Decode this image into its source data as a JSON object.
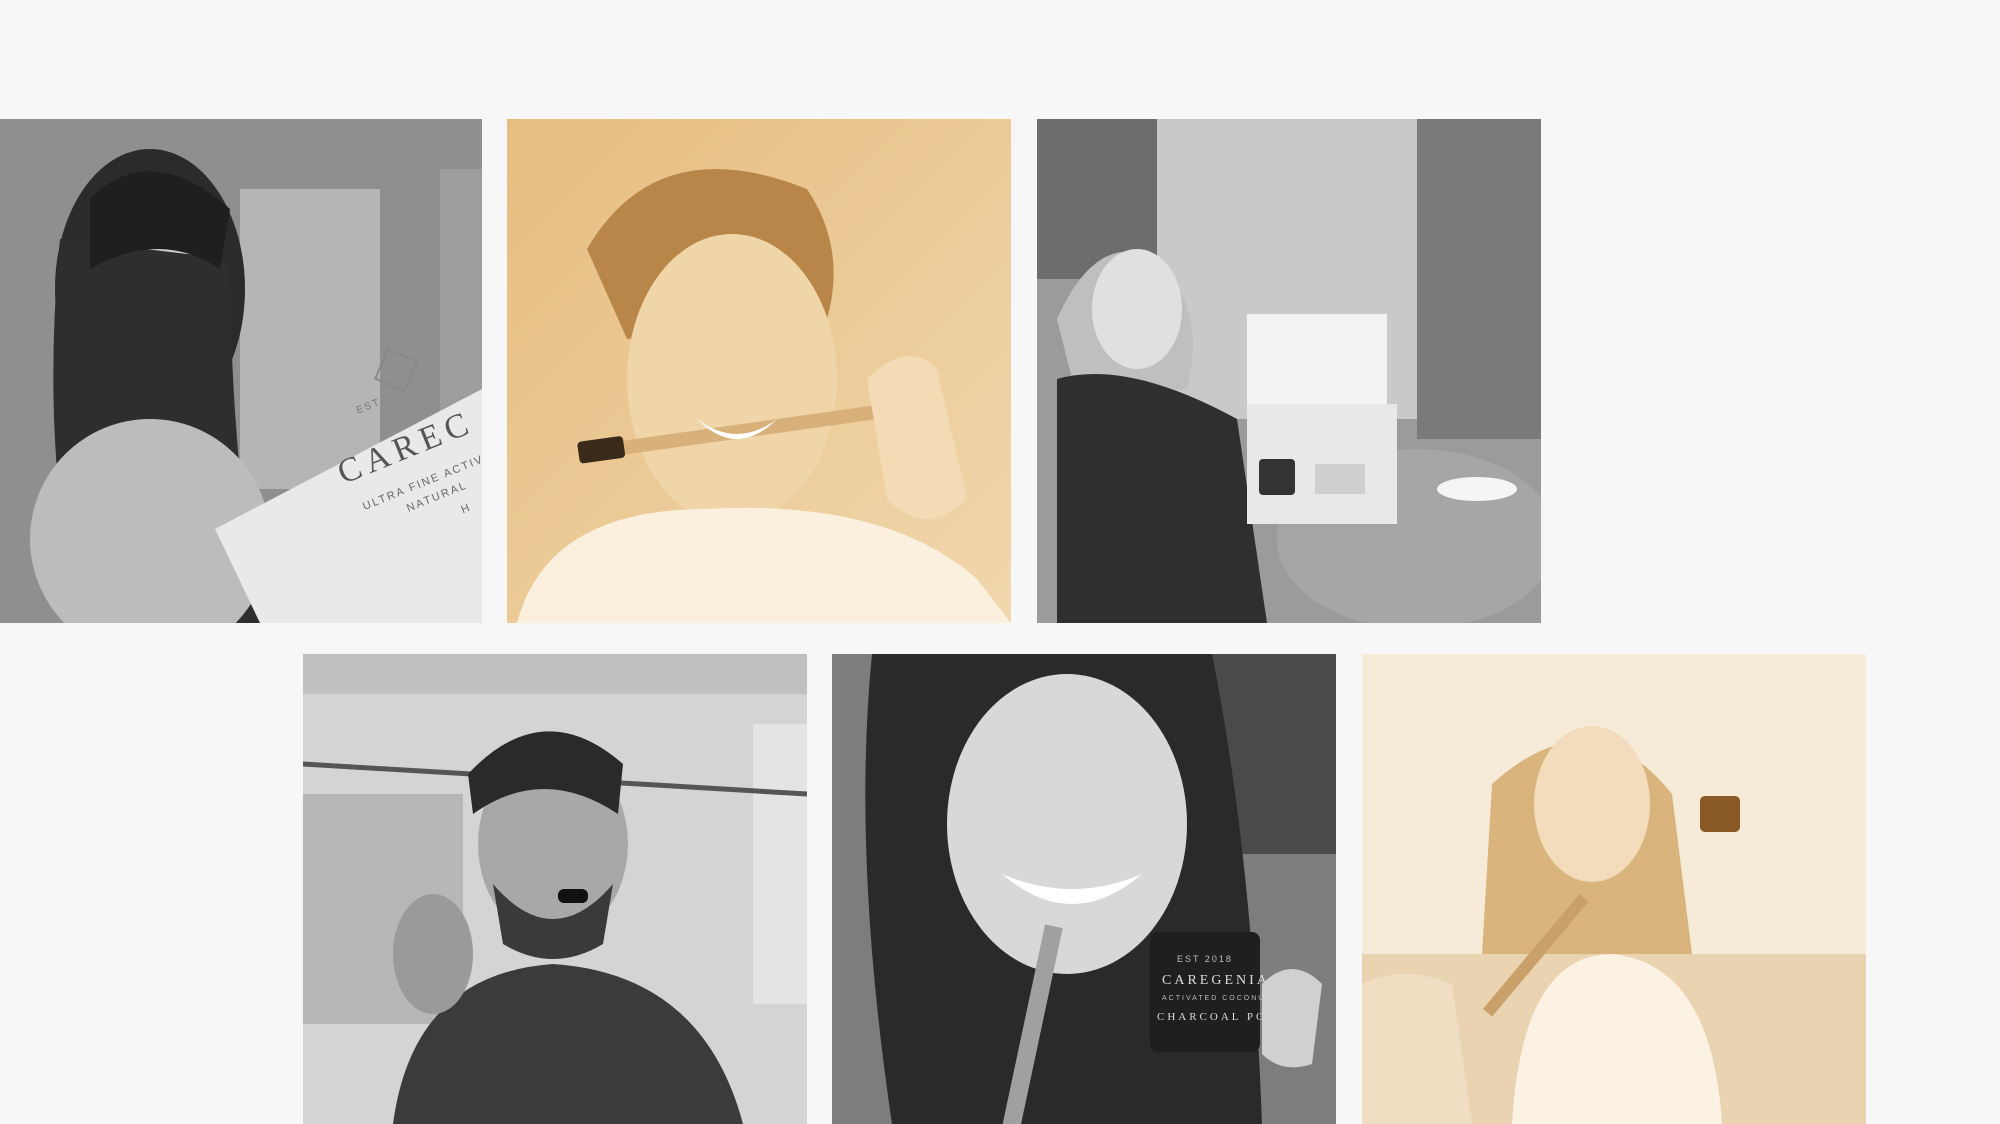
{
  "gallery": {
    "tiles": [
      {
        "tone": "grayscale",
        "box_est": "EST",
        "box_brand": "CAREC",
        "box_line1": "ULTRA FINE ACTIVAT",
        "box_line2": "NATURAL",
        "box_line3": "H"
      },
      {
        "tone": "sepia"
      },
      {
        "tone": "grayscale"
      },
      {
        "tone": "grayscale"
      },
      {
        "tone": "grayscale",
        "jar_est": "EST 2018",
        "jar_brand": "CAREGENIA",
        "jar_line1": "ACTIVATED COCONUT",
        "jar_line2": "CHARCOAL POWDER"
      },
      {
        "tone": "sepia"
      }
    ]
  },
  "colors": {
    "background": "#f7f7f7",
    "sepia_light": "#f3e4cd",
    "sepia_dark": "#c99a5b",
    "gray_light": "#d9d9d9",
    "gray_dark": "#2a2a2a"
  }
}
